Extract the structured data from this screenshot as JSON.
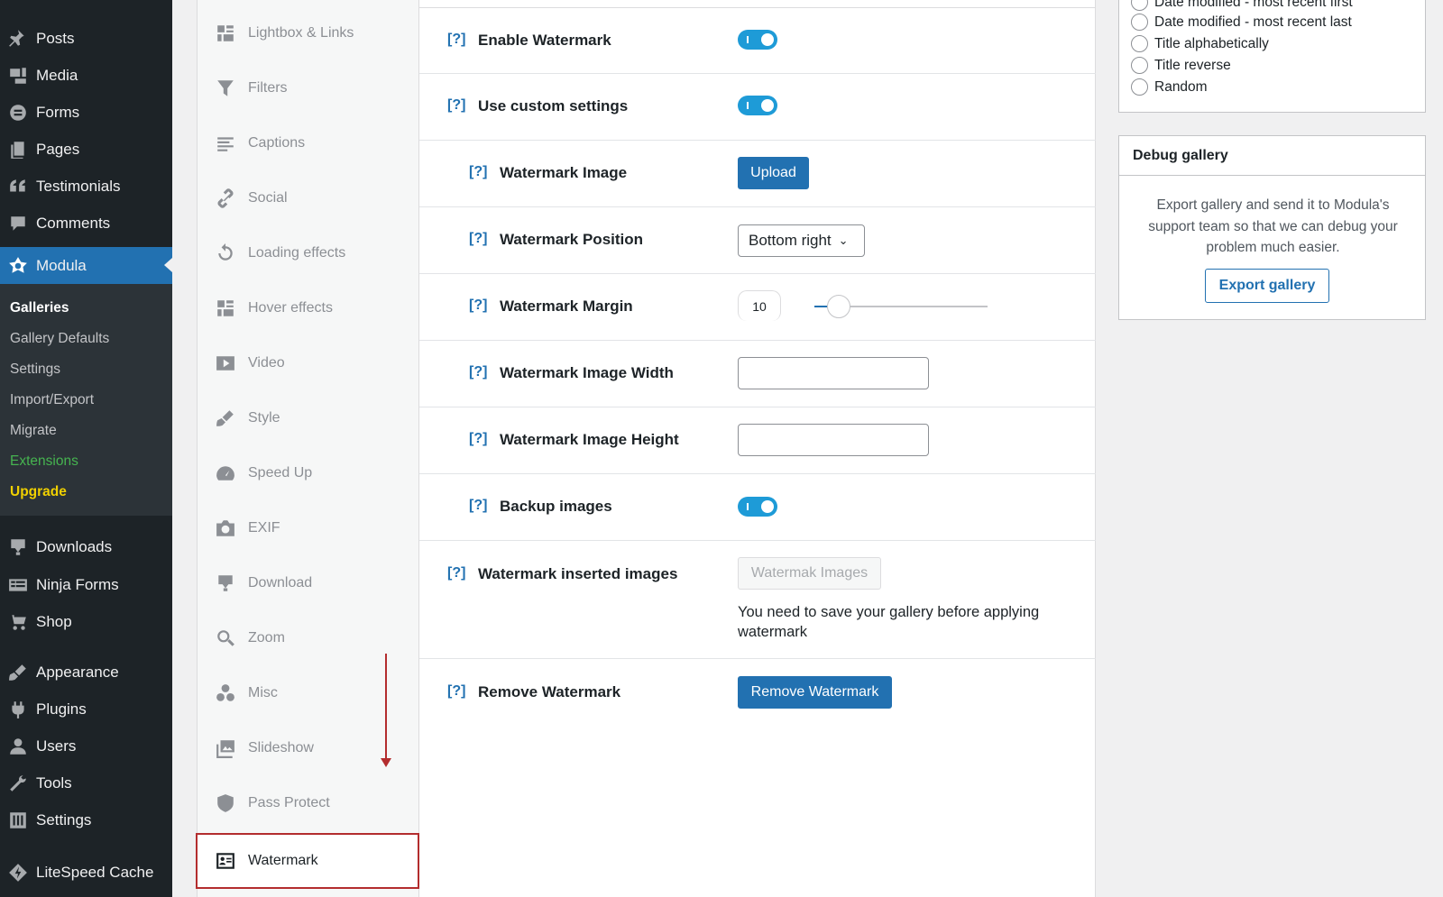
{
  "admin_menu": {
    "items": [
      {
        "label": "Posts",
        "icon": "pushpin-icon"
      },
      {
        "label": "Media",
        "icon": "media-icon"
      },
      {
        "label": "Forms",
        "icon": "forms-icon"
      },
      {
        "label": "Pages",
        "icon": "pages-icon"
      },
      {
        "label": "Testimonials",
        "icon": "quote-icon"
      },
      {
        "label": "Comments",
        "icon": "comment-icon"
      },
      {
        "label": "Modula",
        "icon": "modula-icon"
      },
      {
        "label": "Downloads",
        "icon": "download-icon"
      },
      {
        "label": "Ninja Forms",
        "icon": "ninja-forms-icon"
      },
      {
        "label": "Shop",
        "icon": "cart-icon"
      },
      {
        "label": "Appearance",
        "icon": "brush-icon"
      },
      {
        "label": "Plugins",
        "icon": "plugin-icon"
      },
      {
        "label": "Users",
        "icon": "user-icon"
      },
      {
        "label": "Tools",
        "icon": "wrench-icon"
      },
      {
        "label": "Settings",
        "icon": "settings-icon"
      },
      {
        "label": "LiteSpeed Cache",
        "icon": "litespeed-icon"
      }
    ],
    "current": "Modula",
    "submenu": [
      {
        "label": "Galleries"
      },
      {
        "label": "Gallery Defaults"
      },
      {
        "label": "Settings"
      },
      {
        "label": "Import/Export"
      },
      {
        "label": "Migrate"
      },
      {
        "label": "Extensions"
      },
      {
        "label": "Upgrade"
      }
    ],
    "colors": {
      "extensions": "#46b450",
      "upgrade": "#f0d000",
      "current_bg": "#2271b1"
    }
  },
  "settings_tabs": {
    "items": [
      {
        "label": "Lightbox & Links",
        "icon": "grid-icon"
      },
      {
        "label": "Filters",
        "icon": "filter-icon"
      },
      {
        "label": "Captions",
        "icon": "text-lines-icon"
      },
      {
        "label": "Social",
        "icon": "link-icon"
      },
      {
        "label": "Loading effects",
        "icon": "reload-icon"
      },
      {
        "label": "Hover effects",
        "icon": "grid-icon"
      },
      {
        "label": "Video",
        "icon": "video-icon"
      },
      {
        "label": "Style",
        "icon": "brush-icon"
      },
      {
        "label": "Speed Up",
        "icon": "dashboard-icon"
      },
      {
        "label": "EXIF",
        "icon": "camera-icon"
      },
      {
        "label": "Download",
        "icon": "download-icon"
      },
      {
        "label": "Zoom",
        "icon": "search-icon"
      },
      {
        "label": "Misc",
        "icon": "circles-icon"
      },
      {
        "label": "Slideshow",
        "icon": "images-icon"
      },
      {
        "label": "Pass Protect",
        "icon": "shield-icon"
      },
      {
        "label": "Watermark",
        "icon": "id-card-icon"
      }
    ],
    "active": "Watermark"
  },
  "watermark": {
    "help": "[?]",
    "enable": {
      "label": "Enable Watermark",
      "on": true
    },
    "custom": {
      "label": "Use custom settings",
      "on": true
    },
    "image": {
      "label": "Watermark Image",
      "button": "Upload"
    },
    "position": {
      "label": "Watermark Position",
      "value": "Bottom right"
    },
    "margin": {
      "label": "Watermark Margin",
      "value": "10",
      "slider_fraction": 0.1
    },
    "width": {
      "label": "Watermark Image Width",
      "value": ""
    },
    "height": {
      "label": "Watermark Image Height",
      "value": ""
    },
    "backup": {
      "label": "Backup images",
      "on": true
    },
    "inserted": {
      "label": "Watermark inserted images",
      "button": "Watermak Images",
      "note": "You need to save your gallery before applying watermark"
    },
    "remove": {
      "label": "Remove Watermark",
      "button": "Remove Watermark"
    },
    "toggle_color": "#1e9bd7"
  },
  "sort_box": {
    "options": [
      "Date modified - most recent first",
      "Date modified - most recent last",
      "Title alphabetically",
      "Title reverse",
      "Random"
    ]
  },
  "debug_box": {
    "title": "Debug gallery",
    "text": "Export gallery and send it to Modula's support team so that we can debug your problem much easier.",
    "button": "Export gallery"
  }
}
